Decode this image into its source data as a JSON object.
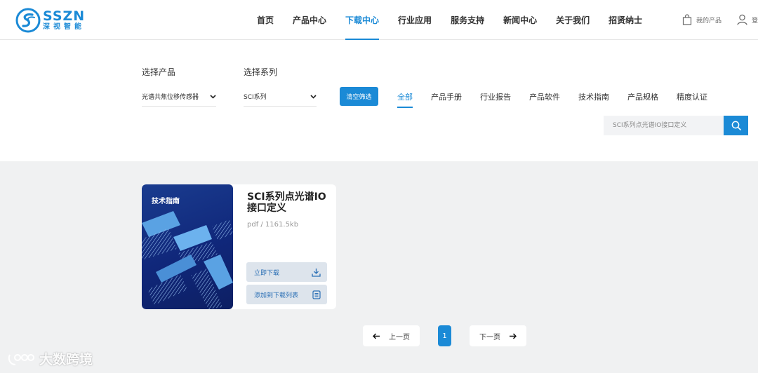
{
  "header": {
    "logo_name": "SSZN",
    "logo_sub": "深视智能",
    "nav": [
      "首页",
      "产品中心",
      "下载中心",
      "行业应用",
      "服务支持",
      "新闻中心",
      "关于我们",
      "招贤纳士"
    ],
    "active_nav": "下载中心",
    "cart_label": "我的产品",
    "user_label": "登"
  },
  "filters": {
    "product_label": "选择产品",
    "product_value": "光谱共焦位移传感器",
    "series_label": "选择系列",
    "series_value": "SCI系列",
    "clear_button": "清空筛选",
    "tabs": [
      "全部",
      "产品手册",
      "行业报告",
      "产品软件",
      "技术指南",
      "产品规格",
      "精度认证"
    ],
    "active_tab": "全部",
    "search_placeholder": "SCI系列点光谱IO接口定义"
  },
  "card": {
    "thumb_label": "技术指南",
    "title": "SCI系列点光谱IO接口定义",
    "meta": "pdf / 1161.5kb",
    "download_button": "立即下载",
    "add_list_button": "添加到下载列表"
  },
  "pagination": {
    "prev": "上一页",
    "current": "1",
    "next": "下一页"
  },
  "watermark": "大数跨境",
  "colors": {
    "accent": "#1b8ad6",
    "content_bg": "#f0f1f2",
    "thumb_bg": "#10277a"
  }
}
